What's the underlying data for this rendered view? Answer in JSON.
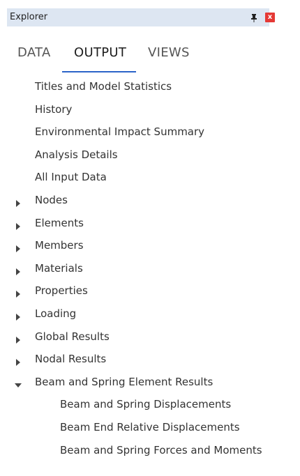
{
  "window": {
    "title": "Explorer",
    "pin_icon": "pin-icon",
    "close_icon": "close-icon",
    "close_glyph": "x",
    "colors": {
      "titlebar_bg": "#dde6f2",
      "close_bg": "#e53935",
      "tab_underline": "#2b63c8"
    }
  },
  "tabs": [
    {
      "label": "DATA",
      "active": false
    },
    {
      "label": "OUTPUT",
      "active": true
    },
    {
      "label": "VIEWS",
      "active": false
    }
  ],
  "tree": {
    "items": [
      {
        "label": "Titles and Model Statistics",
        "expander": "none"
      },
      {
        "label": "History",
        "expander": "none"
      },
      {
        "label": "Environmental Impact Summary",
        "expander": "none"
      },
      {
        "label": "Analysis Details",
        "expander": "none"
      },
      {
        "label": "All Input Data",
        "expander": "none"
      },
      {
        "label": "Nodes",
        "expander": "collapsed"
      },
      {
        "label": "Elements",
        "expander": "collapsed"
      },
      {
        "label": "Members",
        "expander": "collapsed"
      },
      {
        "label": "Materials",
        "expander": "collapsed"
      },
      {
        "label": "Properties",
        "expander": "collapsed"
      },
      {
        "label": "Loading",
        "expander": "collapsed"
      },
      {
        "label": "Global Results",
        "expander": "collapsed"
      },
      {
        "label": "Nodal Results",
        "expander": "collapsed"
      },
      {
        "label": "Beam and Spring Element Results",
        "expander": "expanded"
      }
    ],
    "children": [
      {
        "label": "Beam and Spring Displacements"
      },
      {
        "label": "Beam End Relative Displacements"
      },
      {
        "label": "Beam and Spring Forces and Moments"
      }
    ]
  }
}
